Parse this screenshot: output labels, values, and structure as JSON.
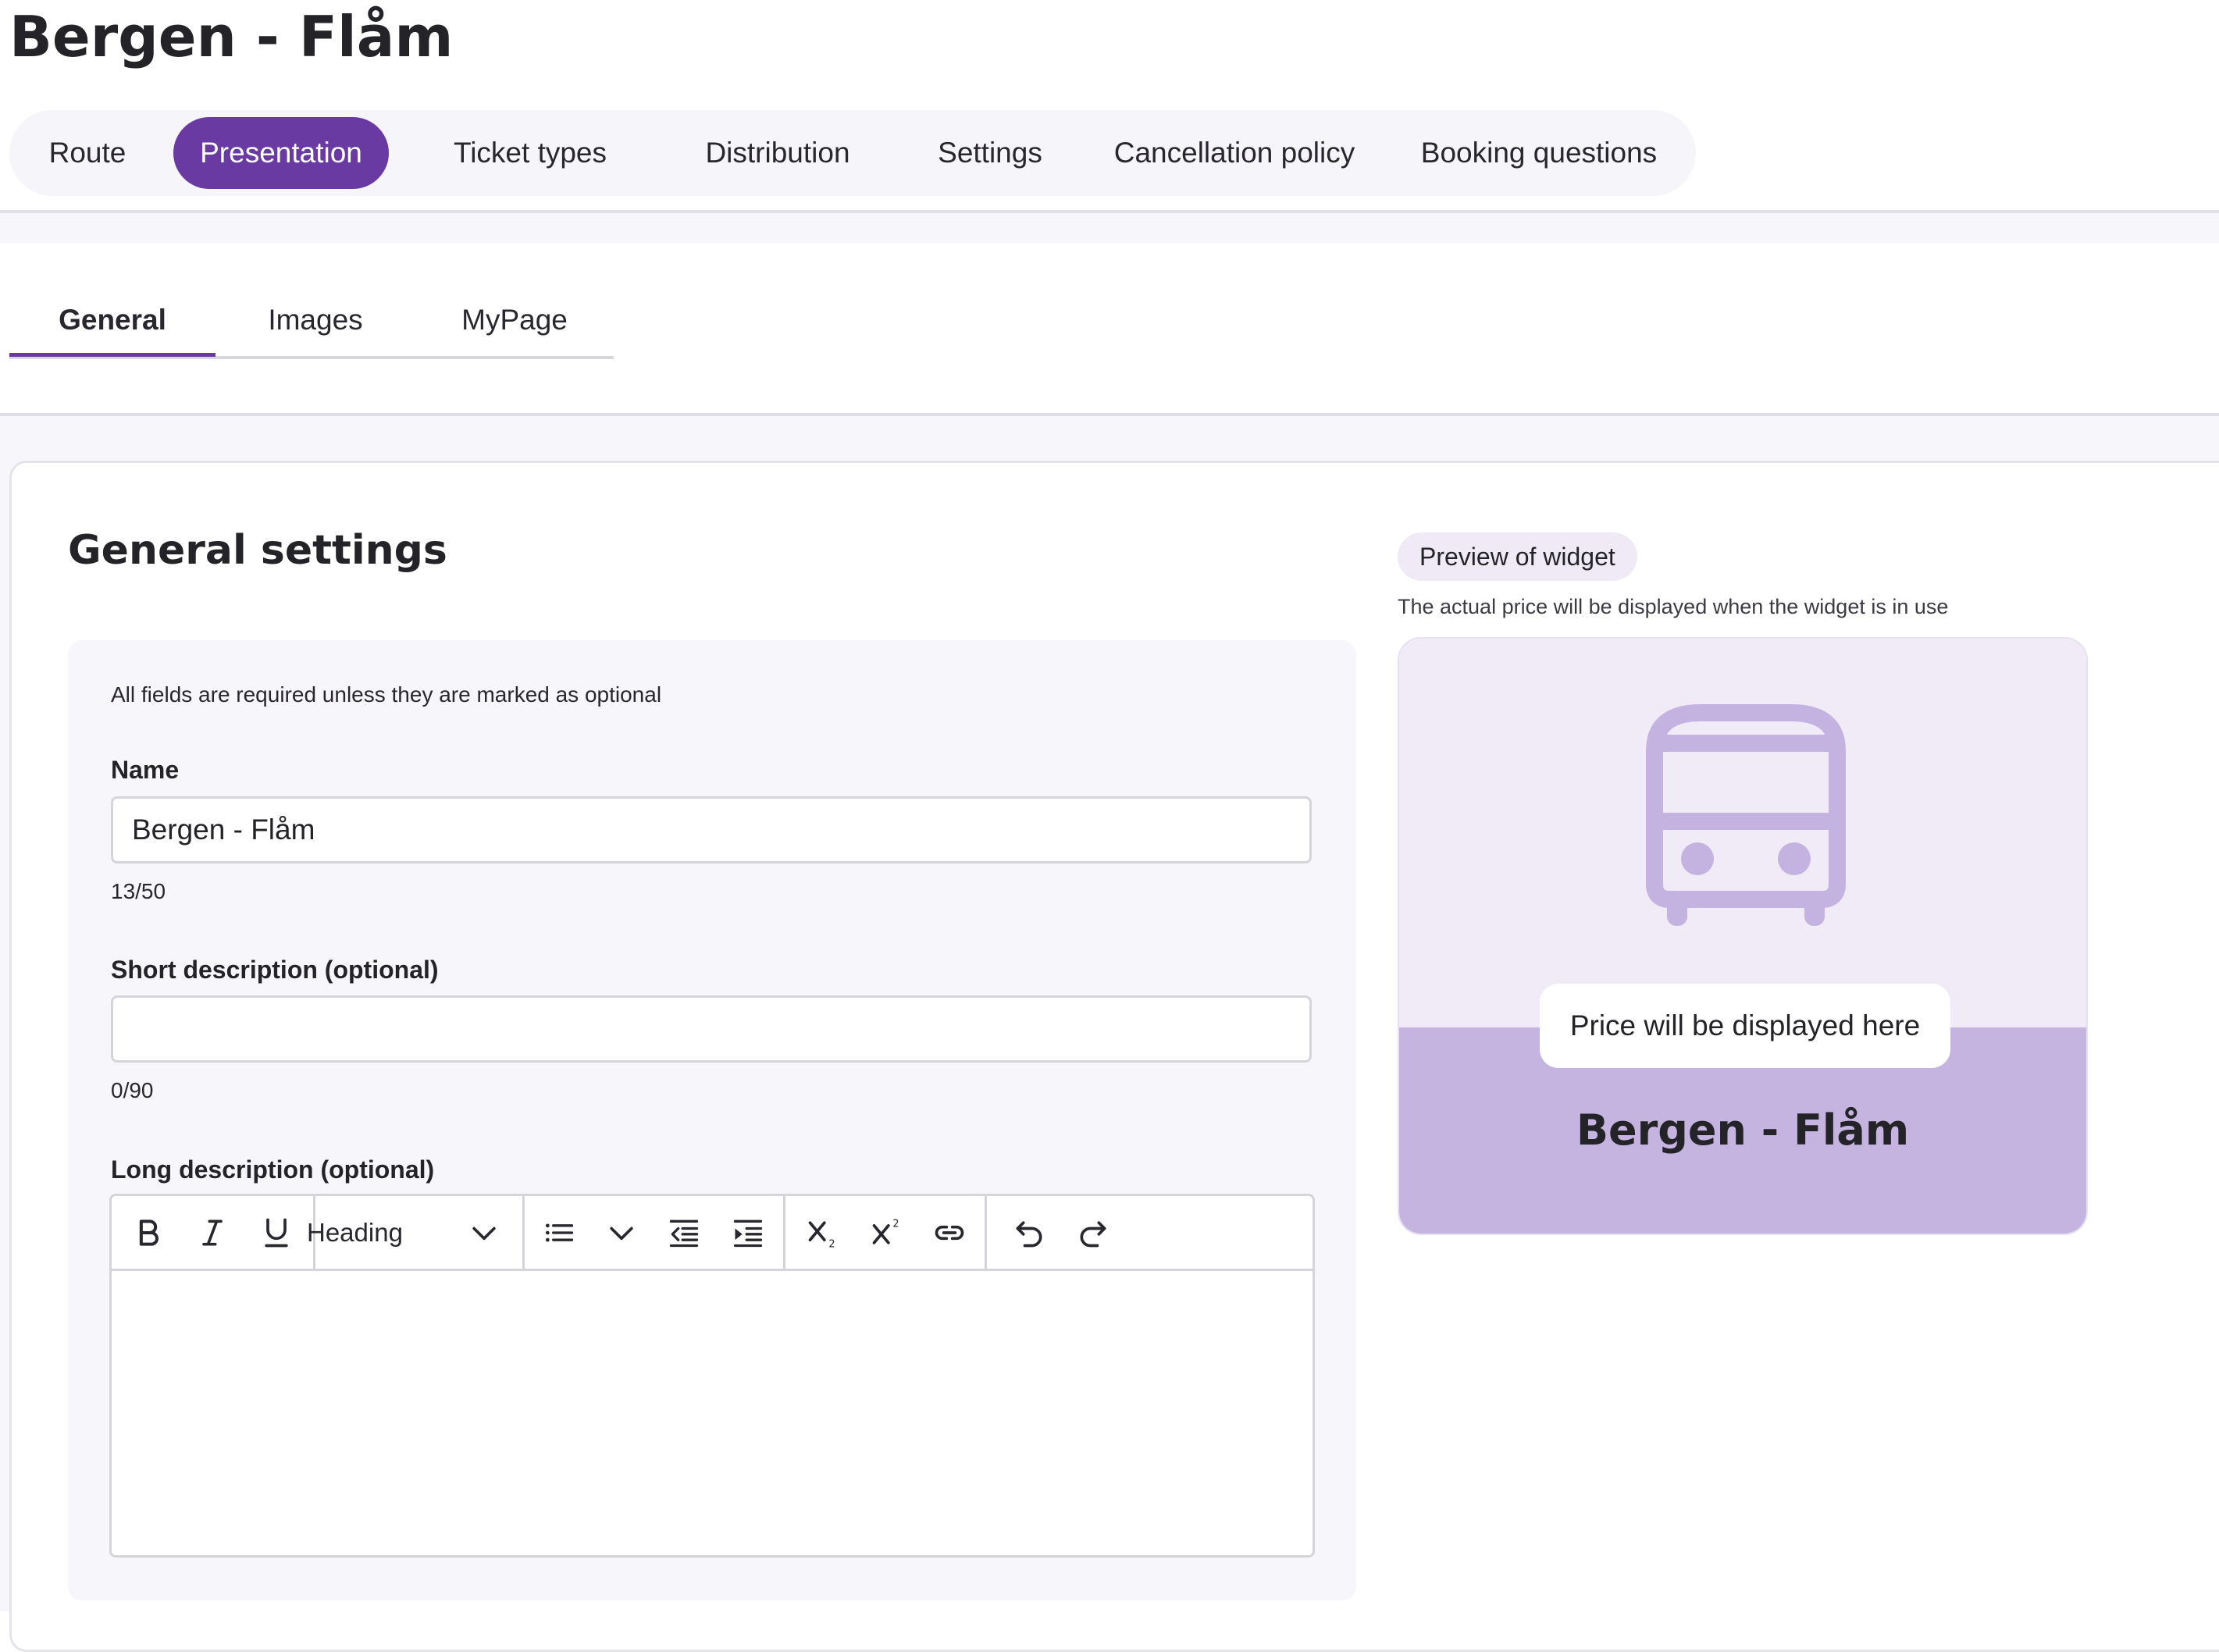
{
  "page": {
    "title": "Bergen - Flåm"
  },
  "main_tabs": [
    {
      "label": "Route"
    },
    {
      "label": "Presentation",
      "active": true
    },
    {
      "label": "Ticket types"
    },
    {
      "label": "Distribution"
    },
    {
      "label": "Settings"
    },
    {
      "label": "Cancellation policy"
    },
    {
      "label": "Booking questions"
    }
  ],
  "sub_tabs": [
    {
      "label": "General",
      "active": true
    },
    {
      "label": "Images"
    },
    {
      "label": "MyPage"
    }
  ],
  "general_settings": {
    "title": "General settings",
    "required_note": "All fields are required unless they are marked as optional",
    "name": {
      "label": "Name",
      "value": "Bergen - Flåm",
      "counter": "13/50"
    },
    "short_description": {
      "label": "Short description (optional)",
      "value": "",
      "counter": "0/90"
    },
    "long_description": {
      "label": "Long description (optional)",
      "toolbar": {
        "heading_label": "Heading",
        "icons": [
          "bold-icon",
          "italic-icon",
          "underline-icon",
          "chevron-down-icon",
          "bullet-list-icon",
          "chevron-down-icon",
          "outdent-icon",
          "indent-icon",
          "subscript-icon",
          "superscript-icon",
          "link-icon",
          "undo-icon",
          "redo-icon"
        ]
      },
      "value": ""
    }
  },
  "preview": {
    "badge": "Preview of widget",
    "note": "The actual price will be displayed when the widget is in use",
    "price_text": "Price will be displayed here",
    "name": "Bergen - Flåm",
    "icon": "bus-icon"
  },
  "colors": {
    "accent": "#6a3aa3",
    "widget_top": "#f1ebf8",
    "widget_bottom": "#c5b4e0",
    "bus_icon": "#c4b2e0"
  }
}
